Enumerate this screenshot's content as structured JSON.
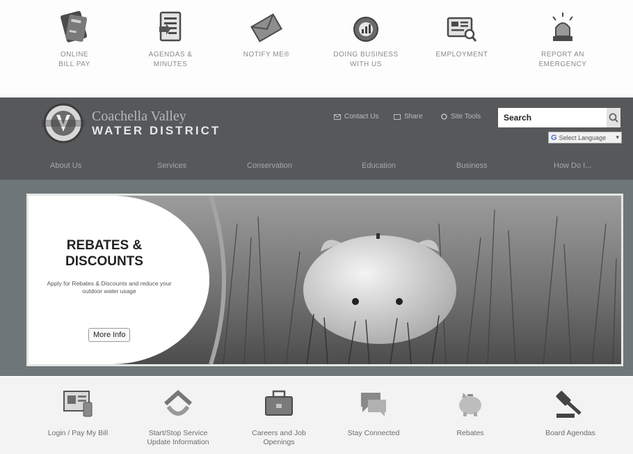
{
  "quick_links": [
    {
      "line1": "ONLINE",
      "line2": "BILL PAY"
    },
    {
      "line1": "AGENDAS &",
      "line2": "MINUTES"
    },
    {
      "line1": "NOTIFY ME®",
      "line2": ""
    },
    {
      "line1": "DOING BUSINESS",
      "line2": "WITH US"
    },
    {
      "line1": "EMPLOYMENT",
      "line2": ""
    },
    {
      "line1": "REPORT AN",
      "line2": "EMERGENCY"
    }
  ],
  "header": {
    "logo_top": "Coachella Valley",
    "logo_bottom": "WATER DISTRICT",
    "util_links": [
      "Contact Us",
      "Share",
      "Site Tools"
    ],
    "search_placeholder": "Search",
    "translate_label": "Select Language"
  },
  "nav": [
    "About Us",
    "Services",
    "Conservation",
    "Education",
    "Business",
    "How Do I..."
  ],
  "promo": {
    "title": "REBATES & DISCOUNTS",
    "description": "Apply for Rebates & Discounts and reduce your outdoor water usage",
    "button": "More Info"
  },
  "services": [
    {
      "line1": "Login / Pay My Bill",
      "line2": ""
    },
    {
      "line1": "Start/Stop Service",
      "line2": "Update Information"
    },
    {
      "line1": "Careers and Job",
      "line2": "Openings"
    },
    {
      "line1": "Stay Connected",
      "line2": ""
    },
    {
      "line1": "Rebates",
      "line2": ""
    },
    {
      "line1": "Board Agendas",
      "line2": ""
    }
  ],
  "colors": {
    "header_bg": "#56585a",
    "hero_bg": "#6f7679"
  }
}
